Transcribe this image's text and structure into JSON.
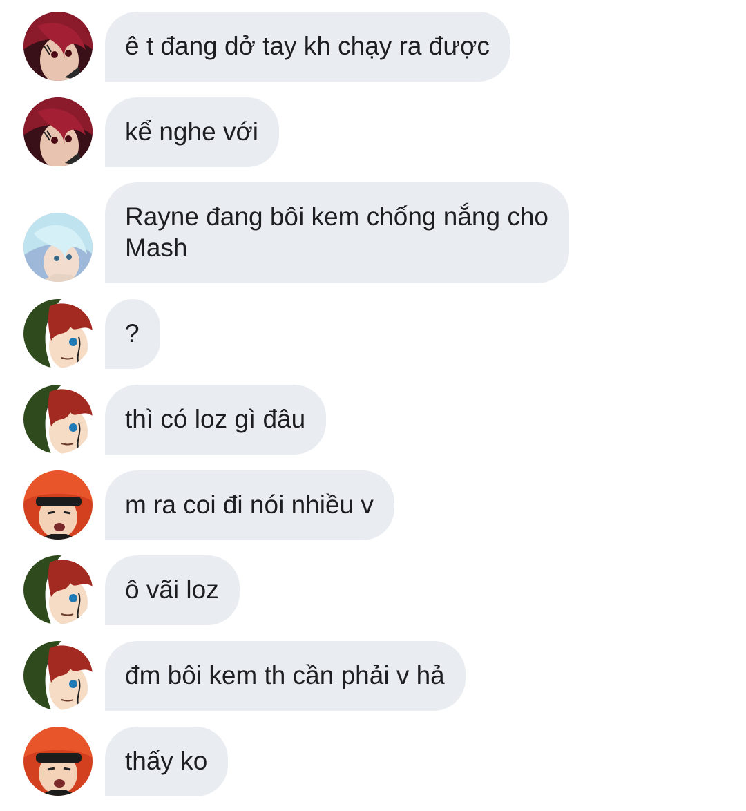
{
  "messages": [
    {
      "sender_avatar": "crimson-hair-avatar",
      "text": "ê t đang dở tay kh chạy ra được"
    },
    {
      "sender_avatar": "crimson-hair-avatar",
      "text": "kể nghe với"
    },
    {
      "sender_avatar": "ice-blue-hair-avatar",
      "text": "Rayne đang bôi kem chống nắng cho\nMash"
    },
    {
      "sender_avatar": "red-hair-green-hood-avatar",
      "text": "?"
    },
    {
      "sender_avatar": "red-hair-green-hood-avatar",
      "text": "thì có loz gì đâu"
    },
    {
      "sender_avatar": "orange-hair-headband-avatar",
      "text": "m ra coi đi nói nhiều v"
    },
    {
      "sender_avatar": "red-hair-green-hood-avatar",
      "text": "ô vãi loz"
    },
    {
      "sender_avatar": "red-hair-green-hood-avatar",
      "text": "đm bôi kem th cần phải v hả"
    },
    {
      "sender_avatar": "orange-hair-headband-avatar",
      "text": "thấy ko"
    }
  ],
  "colors": {
    "bubble_bg": "#e9edf1",
    "text": "#1c1e21",
    "background": "#ffffff"
  }
}
